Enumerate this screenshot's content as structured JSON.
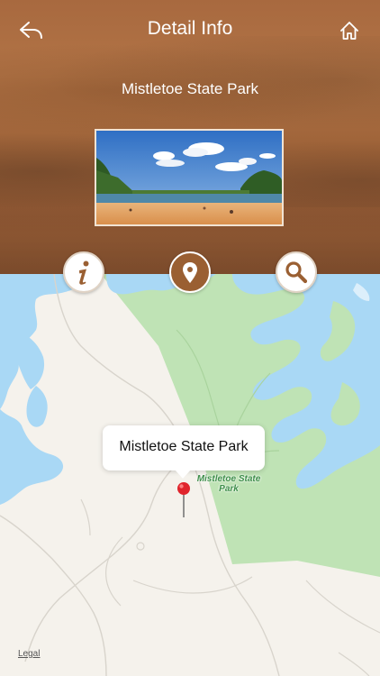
{
  "header": {
    "title": "Detail Info",
    "park_name": "Mistletoe State Park"
  },
  "icons": {
    "back": "reply-arrow-icon",
    "home": "home-icon",
    "info": "info-icon",
    "map": "location-pin-icon",
    "search": "search-icon"
  },
  "map": {
    "callout_title": "Mistletoe State Park",
    "park_label": "Mistletoe State Park",
    "legal_link": "Legal"
  },
  "colors": {
    "header_brown": "#9d6238",
    "accent_brown": "#9a5f32",
    "water": "#a9d8f5",
    "park_green": "#bfe3b5",
    "land": "#f5f2ec",
    "pin_red": "#e0242c"
  }
}
